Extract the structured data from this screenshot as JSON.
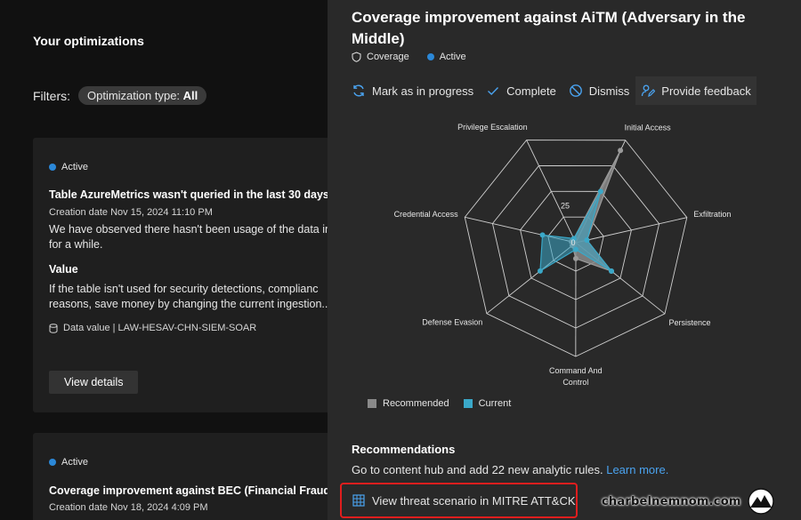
{
  "left": {
    "title": "Your optimizations",
    "filters_label": "Filters:",
    "filter_pill_prefix": "Optimization type:",
    "filter_pill_value": "All",
    "cards": [
      {
        "status": "Active",
        "title": "Table AzureMetrics wasn't queried in the last 30 days",
        "date": "Creation date  Nov 15, 2024 11:10 PM",
        "desc_line1": "We have observed there hasn't been usage of the data in",
        "desc_line2": "for a while.",
        "value_heading": "Value",
        "value_line1": "If the table isn't used for security detections, complianc",
        "value_line2": "reasons, save money by changing the current ingestion..",
        "data_value": "Data value  |  LAW-HESAV-CHN-SIEM-SOAR",
        "button": "View details"
      },
      {
        "status": "Active",
        "title": "Coverage improvement against BEC (Financial Fraud)",
        "date": "Creation date  Nov 18, 2024 4:09 PM"
      }
    ]
  },
  "panel": {
    "title": "Coverage improvement against AiTM (Adversary in the Middle)",
    "meta": {
      "tag": "Coverage",
      "status": "Active"
    },
    "toolbar": {
      "mark": "Mark as in progress",
      "complete": "Complete",
      "dismiss": "Dismiss",
      "feedback": "Provide feedback"
    },
    "legend": {
      "recommended": "Recommended",
      "current": "Current"
    },
    "recommendations": {
      "title": "Recommendations",
      "text": "Go to content hub and add 22 new analytic rules.",
      "link": "Learn more."
    },
    "mitre_button": "View threat scenario in MITRE ATT&CK",
    "watermark": "charbelnemnom.com"
  },
  "colors": {
    "accent_blue": "#2b88d8",
    "recommended": "#8a8a8a",
    "current": "#3aa8c8",
    "highlight_border": "#e01e1e"
  },
  "chart_data": {
    "type": "radar",
    "categories": [
      "Initial Access",
      "Exfiltration",
      "Persistence",
      "Command And Control",
      "Defense Evasion",
      "Credential Access",
      "Privilege Escalation"
    ],
    "tick_labels": [
      "0",
      "25"
    ],
    "series": [
      {
        "name": "Recommended",
        "values": [
          45,
          5,
          20,
          7,
          2,
          2,
          2
        ]
      },
      {
        "name": "Current",
        "values": [
          25,
          5,
          20,
          3,
          20,
          15,
          2
        ]
      }
    ],
    "grid": true,
    "legend_position": "bottom-left"
  }
}
